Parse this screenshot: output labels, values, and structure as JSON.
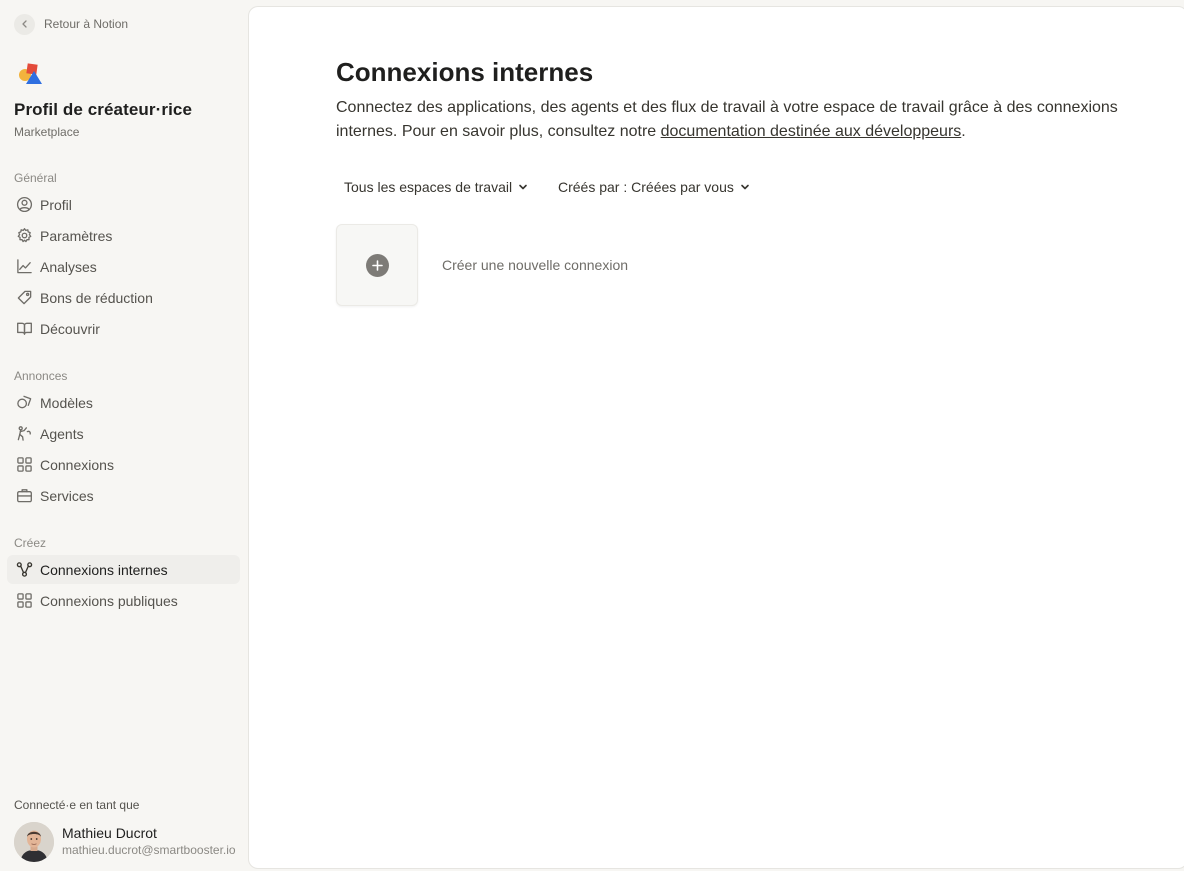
{
  "sidebar": {
    "back_label": "Retour à Notion",
    "profile_title": "Profil de créateur·rice",
    "profile_subtitle": "Marketplace",
    "sections": [
      {
        "label": "Général",
        "items": [
          {
            "label": "Profil",
            "icon": "user-circle-icon"
          },
          {
            "label": "Paramètres",
            "icon": "gear-icon"
          },
          {
            "label": "Analyses",
            "icon": "chart-line-icon"
          },
          {
            "label": "Bons de réduction",
            "icon": "tag-icon"
          },
          {
            "label": "Découvrir",
            "icon": "book-open-icon"
          }
        ]
      },
      {
        "label": "Annonces",
        "items": [
          {
            "label": "Modèles",
            "icon": "shapes-icon"
          },
          {
            "label": "Agents",
            "icon": "agent-icon"
          },
          {
            "label": "Connexions",
            "icon": "grid-icon"
          },
          {
            "label": "Services",
            "icon": "briefcase-icon"
          }
        ]
      },
      {
        "label": "Créez",
        "items": [
          {
            "label": "Connexions internes",
            "icon": "nodes-icon",
            "active": true
          },
          {
            "label": "Connexions publiques",
            "icon": "grid-icon"
          }
        ]
      }
    ],
    "connected_label": "Connecté·e en tant que",
    "user": {
      "name": "Mathieu Ducrot",
      "email": "mathieu.ducrot@smartbooster.io"
    }
  },
  "main": {
    "title": "Connexions internes",
    "description_text": "Connectez des applications, des agents et des flux de travail à votre espace de travail grâce à des connexions internes. Pour en savoir plus, consultez notre ",
    "description_link": "documentation destinée aux développeurs",
    "description_end": ".",
    "filters": {
      "workspace": "Tous les espaces de travail",
      "created_by": "Créés par : Créées par vous"
    },
    "new_connection_label": "Créer une nouvelle connexion"
  },
  "colors": {
    "sidebar_bg": "#f7f6f3",
    "main_bg": "#ffffff",
    "active_item_bg": "#efeeeb",
    "text": "#37352f",
    "muted_text": "#6f6d68",
    "logo_red": "#e34b3a",
    "logo_yellow": "#f2b33d",
    "logo_blue": "#2f6fe0"
  }
}
